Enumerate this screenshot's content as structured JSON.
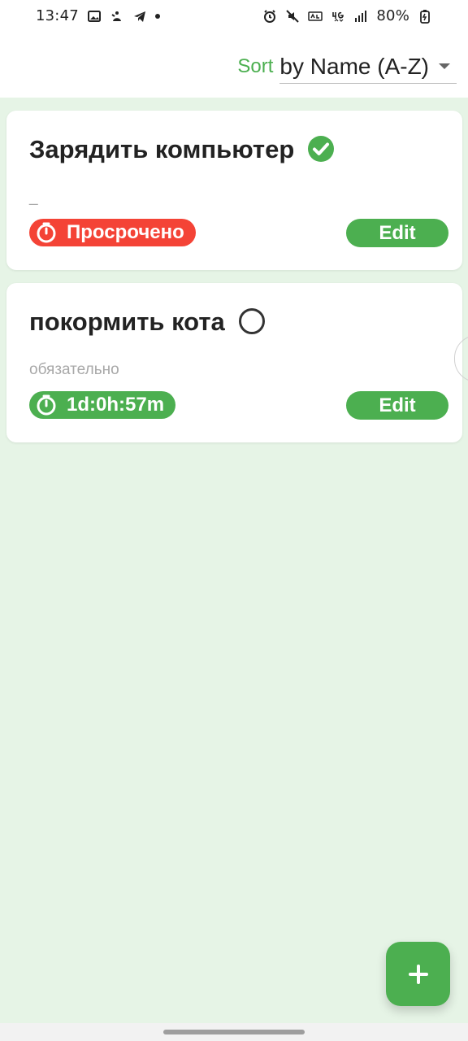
{
  "statusbar": {
    "time": "13:47",
    "battery": "80%",
    "left_icons": [
      "image-icon",
      "app-icon",
      "telegram-icon",
      "dot-icon"
    ],
    "right_icons": [
      "alarm-icon",
      "mute-icon",
      "volte-icon",
      "4g-icon",
      "signal-icon",
      "battery-icon"
    ]
  },
  "sort": {
    "label": "Sort",
    "value": "by Name (A-Z)"
  },
  "tasks": [
    {
      "title": "Зарядить компьютер",
      "description": "_",
      "timer_label": "Просрочено",
      "status": "done",
      "timer_color": "#f44336",
      "edit_label": "Edit"
    },
    {
      "title": "покормить кота",
      "description": "обязательно",
      "timer_label": "1d:0h:57m",
      "status": "open",
      "timer_color": "#4caf50",
      "edit_label": "Edit"
    }
  ],
  "colors": {
    "accent": "#4caf50",
    "danger": "#f44336",
    "background": "#e6f4e6"
  }
}
